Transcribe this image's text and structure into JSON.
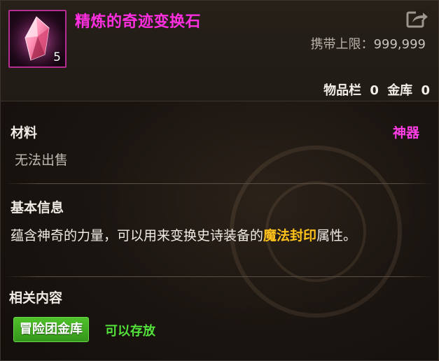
{
  "item": {
    "name": "精炼的奇迹变换石",
    "count": "5",
    "icon": "crystal-icon",
    "name_color": "#ff2fe0"
  },
  "header": {
    "limit_label": "携带上限：",
    "limit_value": "999,999",
    "inventory_label": "物品栏",
    "inventory_value": "0",
    "bank_label": "金库",
    "bank_value": "0",
    "share_icon": "share-icon"
  },
  "material": {
    "title": "材料",
    "rarity": "神器",
    "rarity_color": "#ff3ee6",
    "sell_note": "无法出售"
  },
  "basic_info": {
    "title": "基本信息",
    "desc_before": "蕴含神奇的力量，可以用来变换史诗装备的",
    "desc_highlight": "魔法封印",
    "desc_after": "属性。",
    "highlight_color": "#ffc21a"
  },
  "related": {
    "title": "相关内容",
    "button_label": "冒险团金库",
    "status": "可以存放",
    "button_color": "#4fc12a",
    "status_color": "#53e23a"
  }
}
